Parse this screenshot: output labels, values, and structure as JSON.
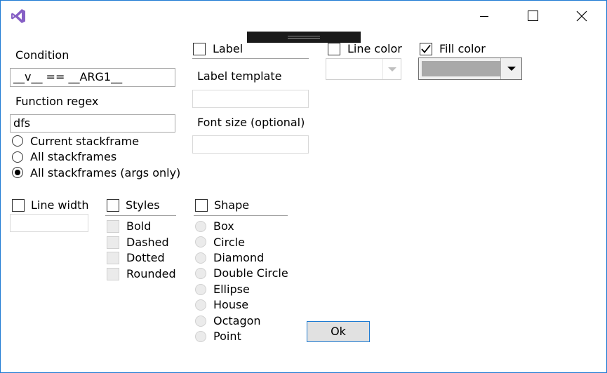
{
  "window": {
    "app_icon": "visual-studio-icon",
    "minimize_icon": "minimize-icon",
    "maximize_icon": "maximize-icon",
    "close_icon": "close-icon"
  },
  "condition": {
    "label": "Condition",
    "value": "__v__ == __ARG1__"
  },
  "function_regex": {
    "label": "Function regex",
    "value": "dfs"
  },
  "stackframes": {
    "options": [
      "Current stackframe",
      "All stackframes",
      "All stackframes (args only)"
    ],
    "selected": "All stackframes (args only)"
  },
  "label_section": {
    "checkbox_label": "Label",
    "template_label": "Label template",
    "template_value": "",
    "font_size_label": "Font size (optional)",
    "font_size_value": ""
  },
  "line_color": {
    "label": "Line color",
    "checked": false
  },
  "fill_color": {
    "label": "Fill color",
    "checked": true,
    "swatch": "#a9a9a9"
  },
  "line_width": {
    "label": "Line width",
    "value": ""
  },
  "styles": {
    "label": "Styles",
    "options": [
      "Bold",
      "Dashed",
      "Dotted",
      "Rounded"
    ]
  },
  "shape": {
    "label": "Shape",
    "options": [
      "Box",
      "Circle",
      "Diamond",
      "Double Circle",
      "Ellipse",
      "House",
      "Octagon",
      "Point"
    ]
  },
  "ok_button": {
    "label": "Ok"
  },
  "colors": {
    "accent": "#1e7bd3",
    "vs_purple": "#865fc5"
  }
}
